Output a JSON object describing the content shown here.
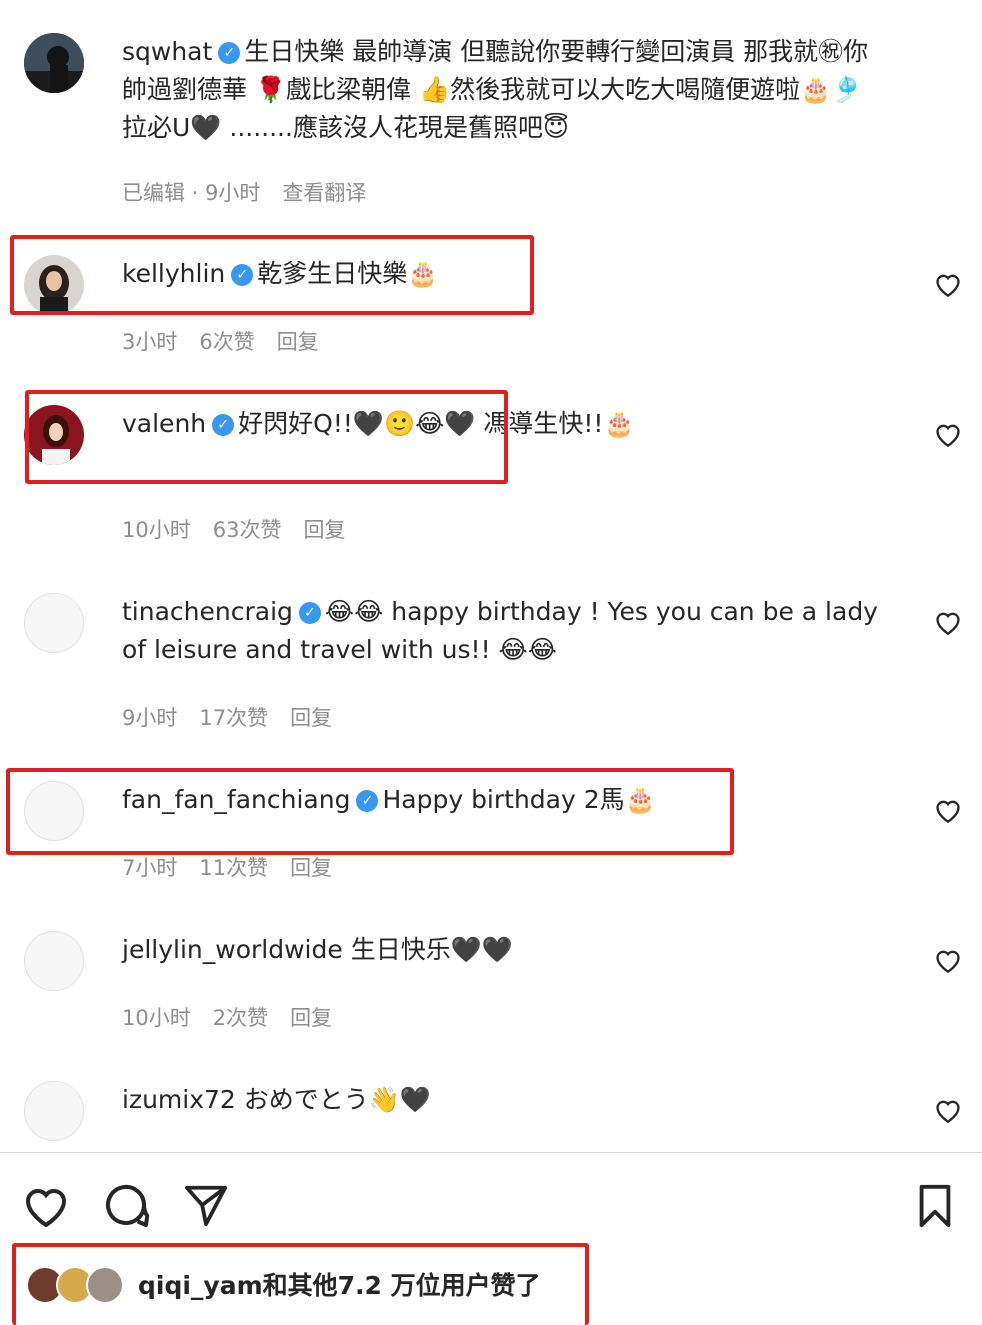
{
  "comments": [
    {
      "username": "sqwhat",
      "text": "生日快樂 最帥導演 但聽說你要轉行變回演員 那我就㊗你 帥過劉德華 🌹戲比梁朝偉 👍然後我就可以大吃大喝隨便遊啦🎂🎐拉必U🖤 ........應該沒人花現是舊照吧😇",
      "meta": {
        "time": "已编辑 · 9小时",
        "translate": "查看翻译"
      }
    },
    {
      "username": "kellyhlin",
      "text": "乾爹生日快樂🎂",
      "meta": {
        "time": "3小时",
        "likes": "6次赞",
        "reply": "回复"
      }
    },
    {
      "username": "valenh",
      "text": "好閃好Q!!🖤🙂😂🖤 馮導生快!!🎂",
      "meta": {
        "time": "10小时",
        "likes": "63次赞",
        "reply": "回复"
      }
    },
    {
      "username": "tinachencraig",
      "text": "😂😂 happy birthday ! Yes you can be a lady of leisure and travel with us!! 😂😂",
      "meta": {
        "time": "9小时",
        "likes": "17次赞",
        "reply": "回复"
      }
    },
    {
      "username": "fan_fan_fanchiang",
      "text": "Happy birthday 2馬🎂",
      "meta": {
        "time": "7小时",
        "likes": "11次赞",
        "reply": "回复"
      }
    },
    {
      "username": "jellylin_worldwide",
      "text": "生日快乐🖤🖤",
      "meta": {
        "time": "10小时",
        "likes": "2次赞",
        "reply": "回复"
      }
    },
    {
      "username": "izumix72",
      "text": "おめでとう👋🖤"
    }
  ],
  "footer": {
    "likes_text": "qiqi_yam和其他7.2 万位用户赞了"
  },
  "icons": {
    "verified": "verified-badge-icon",
    "heart": "heart-icon",
    "comment": "comment-icon",
    "share": "send-icon",
    "save": "bookmark-icon"
  },
  "colors": {
    "highlight": "#e02020",
    "verified": "#3897f0",
    "meta": "#8e8e8e"
  }
}
